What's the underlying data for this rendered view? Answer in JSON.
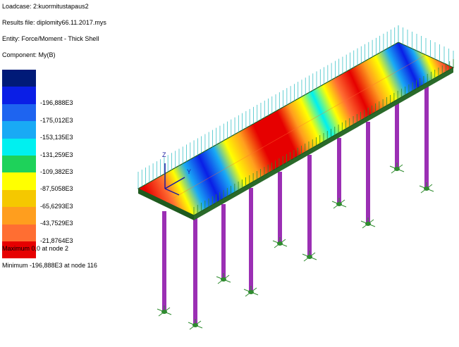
{
  "header": {
    "loadcase": "Loadcase: 2:kuormitustapaus2",
    "results_file": "Results file: diplomity66.11.2017.mys",
    "entity": "Entity: Force/Moment - Thick Shell",
    "component": "Component: My(B)"
  },
  "legend": {
    "bands": [
      {
        "color": "#001a78",
        "label": ""
      },
      {
        "color": "#0a1ee6",
        "label": "-196,888E3"
      },
      {
        "color": "#1e64f0",
        "label": "-175,012E3"
      },
      {
        "color": "#19aaf5",
        "label": "-153,135E3"
      },
      {
        "color": "#00f0f0",
        "label": "-131,259E3"
      },
      {
        "color": "#1ed25a",
        "label": "-109,382E3"
      },
      {
        "color": "#ffff00",
        "label": "-87,5058E3"
      },
      {
        "color": "#f5c800",
        "label": "-65,6293E3"
      },
      {
        "color": "#ff9e1e",
        "label": "-43,7529E3"
      },
      {
        "color": "#ff6e32",
        "label": "-21,8764E3"
      },
      {
        "color": "#e60000",
        "label": ""
      }
    ]
  },
  "summary": {
    "maximum": "Maximum 0,0 at node 2",
    "minimum": "Minimum -196,888E3 at node 116"
  },
  "axes": {
    "z_label": "Z",
    "y_label": "Y"
  },
  "colors": {
    "deck_edge": "#1e5a1e",
    "pillar": "#9b2fb4",
    "load_arrow": "#3fc3c8",
    "support": "#2e8b2e",
    "axis": "#1a1aa0"
  }
}
